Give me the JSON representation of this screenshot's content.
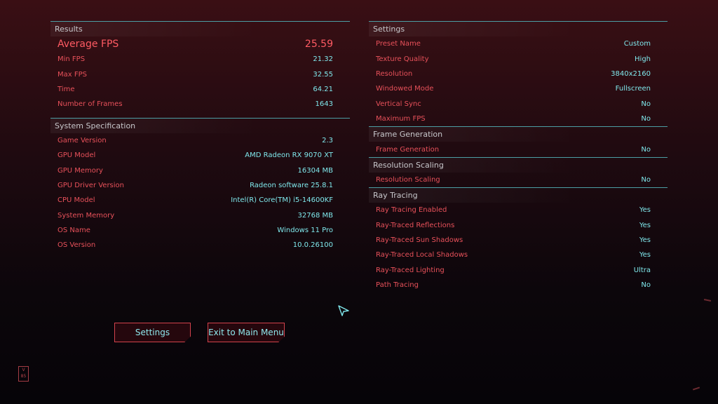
{
  "results": {
    "header": "Results",
    "rows": [
      {
        "label": "Average FPS",
        "value": "25.59"
      },
      {
        "label": "Min FPS",
        "value": "21.32"
      },
      {
        "label": "Max FPS",
        "value": "32.55"
      },
      {
        "label": "Time",
        "value": "64.21"
      },
      {
        "label": "Number of Frames",
        "value": "1643"
      }
    ]
  },
  "system": {
    "header": "System Specification",
    "rows": [
      {
        "label": "Game Version",
        "value": "2.3"
      },
      {
        "label": "GPU Model",
        "value": "AMD Radeon RX 9070 XT"
      },
      {
        "label": "GPU Memory",
        "value": "16304 MB"
      },
      {
        "label": "GPU Driver Version",
        "value": "Radeon software 25.8.1"
      },
      {
        "label": "CPU Model",
        "value": "Intel(R) Core(TM) i5-14600KF"
      },
      {
        "label": "System Memory",
        "value": "32768 MB"
      },
      {
        "label": "OS Name",
        "value": "Windows 11 Pro"
      },
      {
        "label": "OS Version",
        "value": "10.0.26100"
      }
    ]
  },
  "settings": {
    "header": "Settings",
    "rows": [
      {
        "label": "Preset Name",
        "value": "Custom"
      },
      {
        "label": "Texture Quality",
        "value": "High"
      },
      {
        "label": "Resolution",
        "value": "3840x2160"
      },
      {
        "label": "Windowed Mode",
        "value": "Fullscreen"
      },
      {
        "label": "Vertical Sync",
        "value": "No"
      },
      {
        "label": "Maximum FPS",
        "value": "No"
      }
    ]
  },
  "frame_generation": {
    "header": "Frame Generation",
    "rows": [
      {
        "label": "Frame Generation",
        "value": "No"
      }
    ]
  },
  "resolution_scaling": {
    "header": "Resolution Scaling",
    "rows": [
      {
        "label": "Resolution Scaling",
        "value": "No"
      }
    ]
  },
  "ray_tracing": {
    "header": "Ray Tracing",
    "rows": [
      {
        "label": "Ray Tracing Enabled",
        "value": "Yes"
      },
      {
        "label": "Ray-Traced Reflections",
        "value": "Yes"
      },
      {
        "label": "Ray-Traced Sun Shadows",
        "value": "Yes"
      },
      {
        "label": "Ray-Traced Local Shadows",
        "value": "Yes"
      },
      {
        "label": "Ray-Traced Lighting",
        "value": "Ultra"
      },
      {
        "label": "Path Tracing",
        "value": "No"
      }
    ]
  },
  "buttons": {
    "settings": "Settings",
    "exit": "Exit to Main Menu"
  },
  "badge": "V 85",
  "colors": {
    "label": "#e8515a",
    "value": "#7fe7eb",
    "divider": "#4c9ea4",
    "accent": "#d2424c"
  }
}
